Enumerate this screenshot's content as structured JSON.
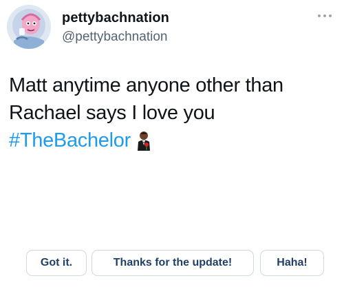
{
  "header": {
    "display_name": "pettybachnation",
    "handle": "@pettybachnation",
    "avatar_icon": "cartoon-avatar-icon",
    "more_icon": "more-options-icon"
  },
  "tweet": {
    "lines": [
      "Matt anytime anyone other than",
      "Rachael says I love you"
    ],
    "hashtag": "#TheBachelor",
    "emoji_icon": "man-in-suit-holding-rose-emoji-icon",
    "hashtag_color": "#1d9bf0"
  },
  "smart_replies": [
    {
      "label": "Got it."
    },
    {
      "label": "Thanks for the update!"
    },
    {
      "label": "Haha!"
    }
  ]
}
